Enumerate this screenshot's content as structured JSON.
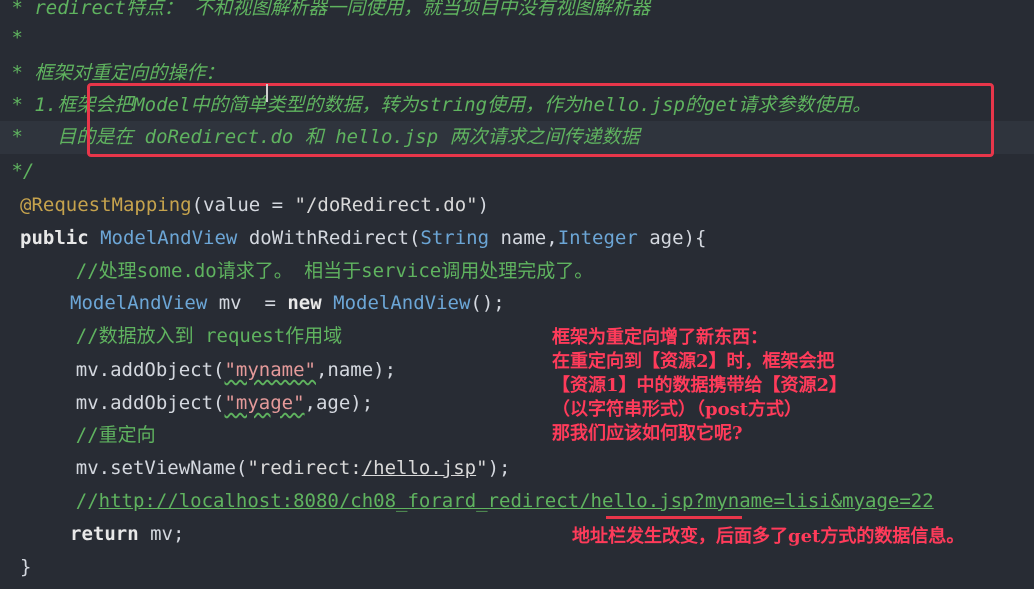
{
  "code": {
    "l1": " * redirect特点： 不和视图解析器一同使用，就当项目中没有视图解析器",
    "l2": " *",
    "l3": " * 框架对重定向的操作：",
    "l4": " * 1.框架会把Model中的简单类型的数据，转为string使用，作为hello.jsp的get请求参数使用。",
    "l5": " *   目的是在 doRedirect.do 和 hello.jsp 两次请求之间传递数据",
    "l6": " */",
    "l7_ann": "@RequestMapping",
    "l7_rest1": "(value = ",
    "l7_str": "\"/doRedirect.do\"",
    "l7_rest2": ")",
    "l8_kw": "public",
    "l8_type1": "ModelAndView",
    "l8_fn": " doWithRedirect(",
    "l8_type2": "String",
    "l8_p1": " name,",
    "l8_type3": "Integer",
    "l8_p2": " age){",
    "l9": "    //处理some.do请求了。 相当于service调用处理完成了。",
    "l10_type": "ModelAndView",
    "l10_mid": " mv  = ",
    "l10_kw": "new",
    "l10_type2": " ModelAndView",
    "l10_end": "();",
    "l11": "    //数据放入到 request作用域",
    "l12_pre": "    mv.addObject(",
    "l12_str": "\"myname\"",
    "l12_end": ",name);",
    "l13_pre": "    mv.addObject(",
    "l13_str": "\"myage\"",
    "l13_end": ",age);",
    "l14": "    //重定向",
    "l15_pre": "    mv.setViewName(",
    "l15_str1": "\"redirect:",
    "l15_str2": "/hello.jsp",
    "l15_str3": "\"",
    "l15_end": ");",
    "l16_pre": "    //",
    "l16_link": "http://localhost:8080/ch08_forard_redirect/hello.jsp?myname=lisi&myage=22",
    "l17_kw": "return",
    "l17_end": " mv;",
    "l18": "}"
  },
  "annotations": {
    "note_lines": "框架为重定向增了新东西：\n在重定向到【资源2】时，框架会把\n【资源1】中的数据携带给【资源2】\n（以字符串形式）（post方式）\n那我们应该如何取它呢?",
    "address_note": "地址栏发生改变，后面多了get方式的数据信息。"
  },
  "colors": {
    "background": "#282c34",
    "comment": "#5fb35f",
    "annotation_red": "#ff3b5a"
  }
}
